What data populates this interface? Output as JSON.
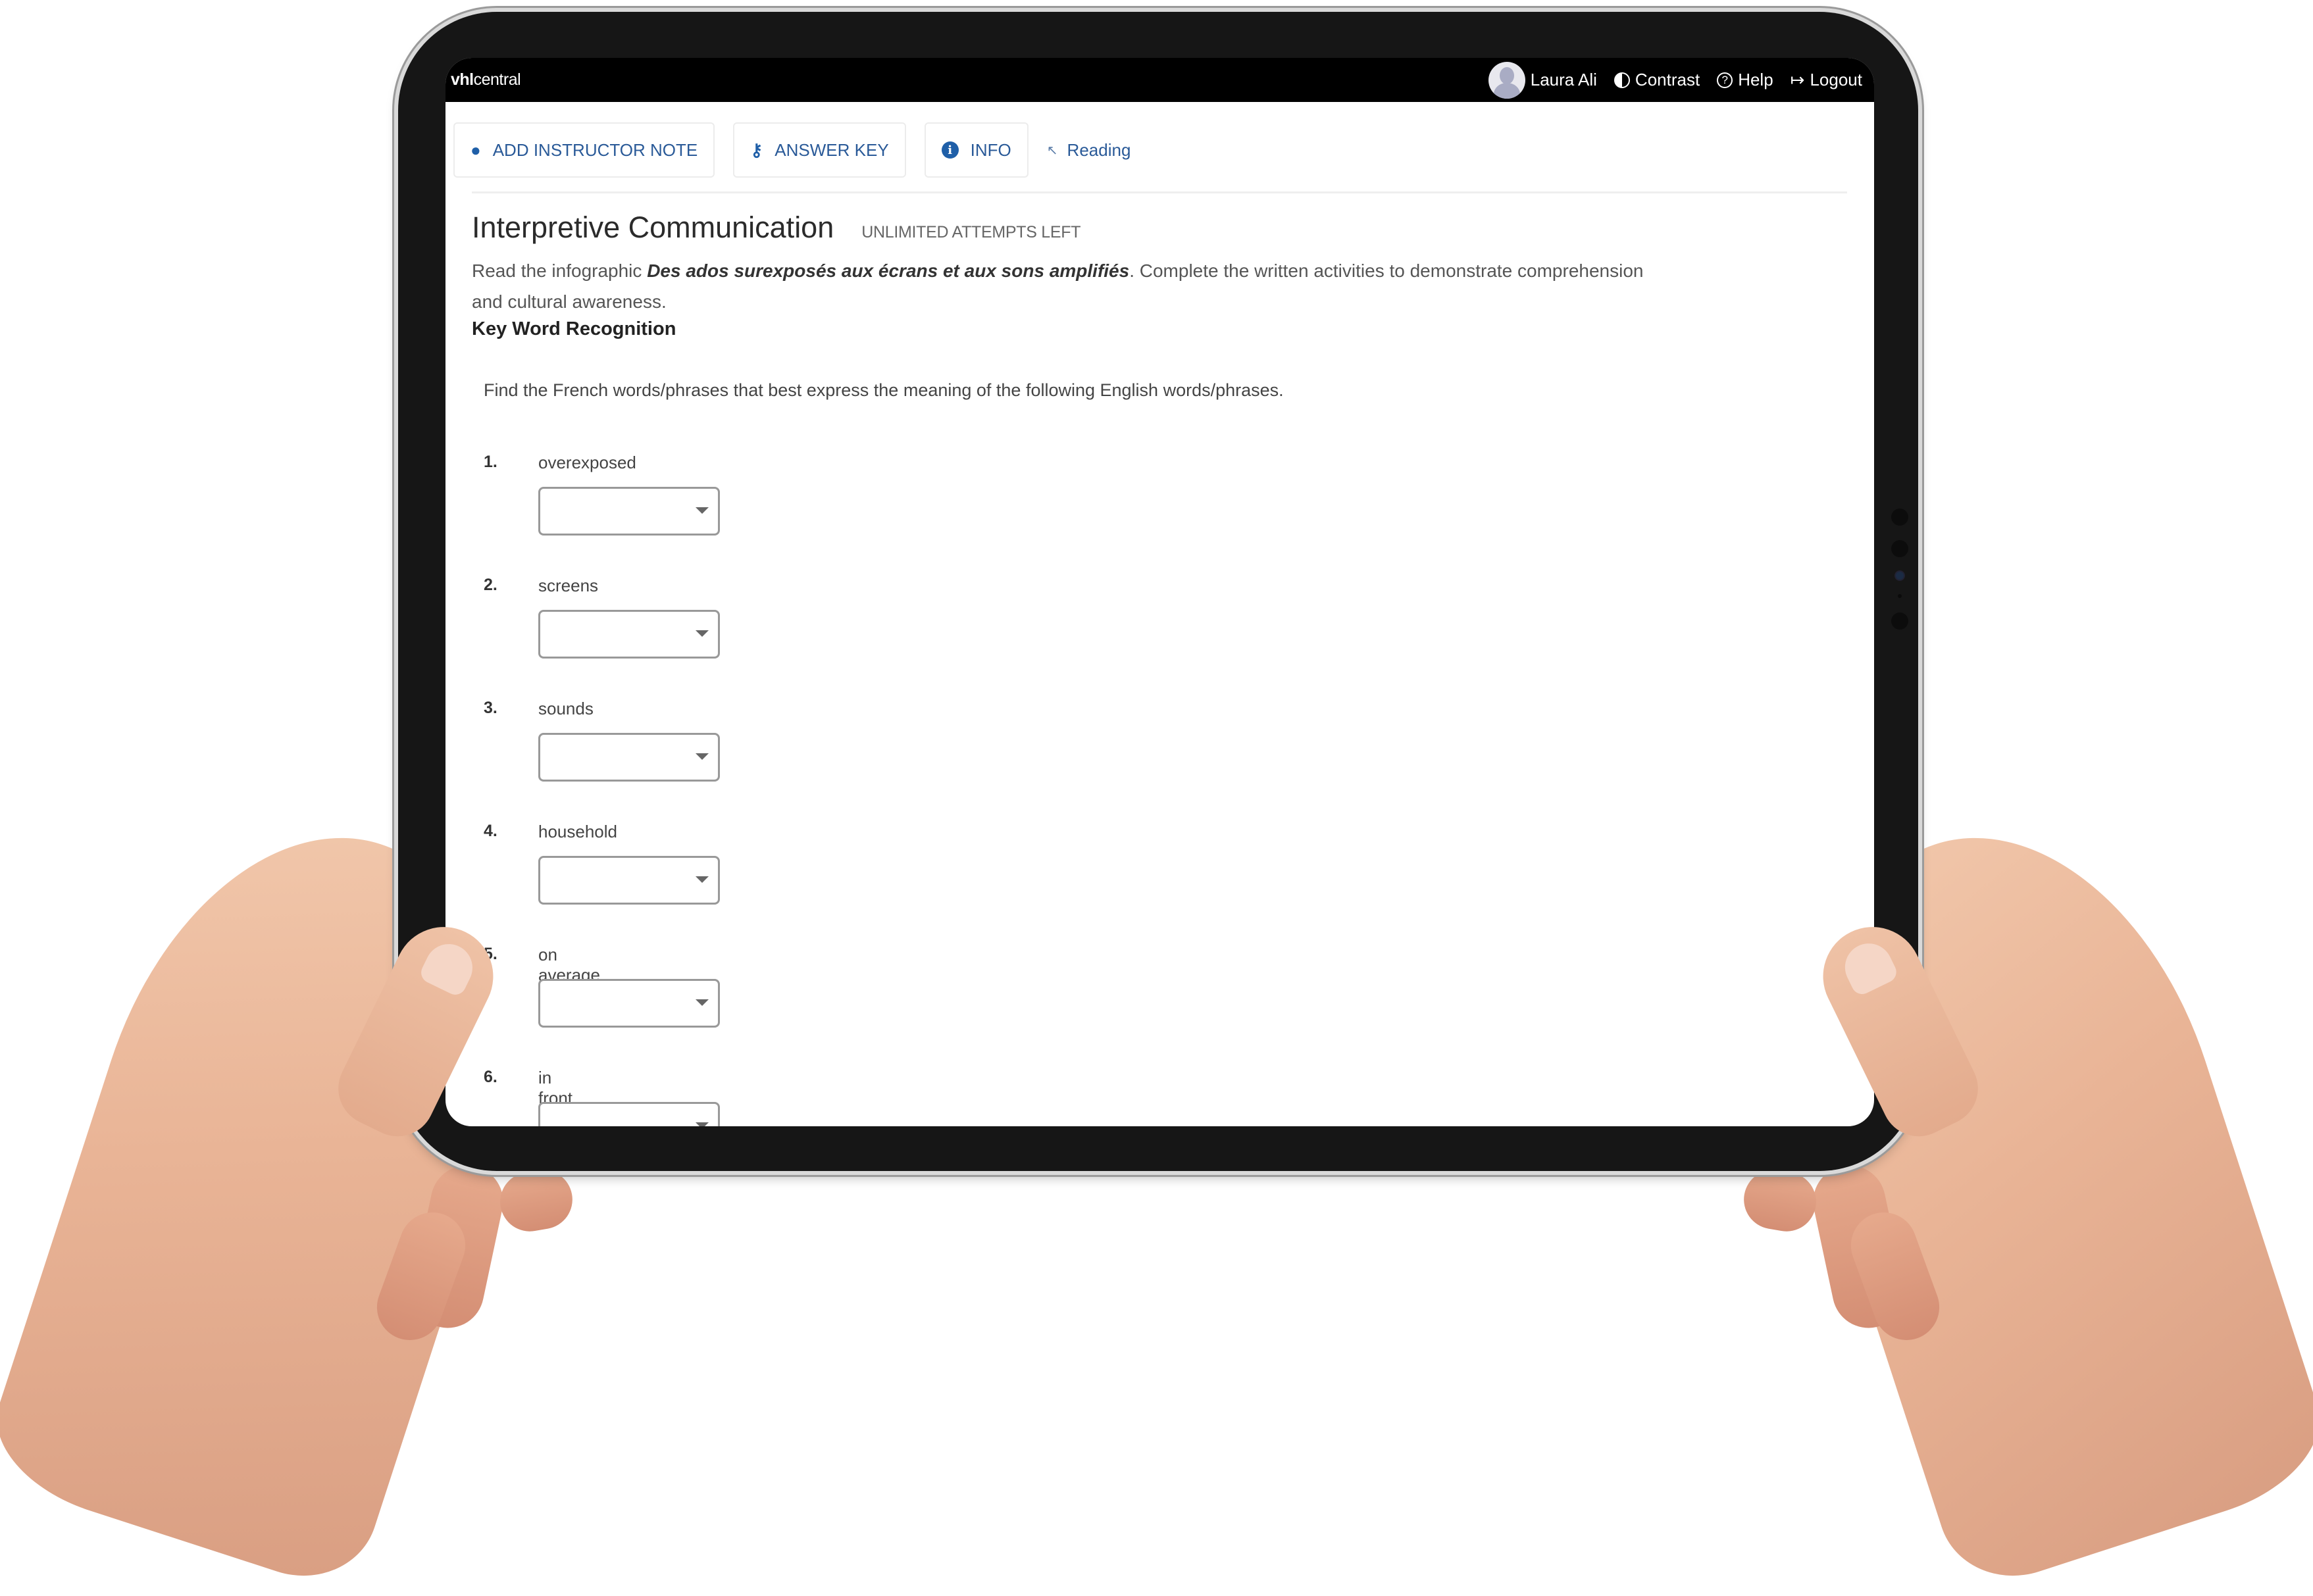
{
  "navbar": {
    "brand_bold": "vhl",
    "brand_rest": "central",
    "user_name": "Laura Ali",
    "contrast_label": "Contrast",
    "help_label": "Help",
    "logout_label": "Logout"
  },
  "toolbar": {
    "add_note_label": "ADD INSTRUCTOR NOTE",
    "answer_key_label": "ANSWER KEY",
    "info_label": "INFO",
    "reading_label": "Reading"
  },
  "activity": {
    "title": "Interpretive Communication",
    "attempts": "UNLIMITED ATTEMPTS LEFT",
    "intro_prefix": "Read the infographic ",
    "intro_title": "Des ados surexposés aux écrans et aux sons amplifiés",
    "intro_suffix": ". Complete the written activities to demonstrate comprehension and cultural awareness.",
    "section_heading": "Key Word Recognition",
    "instructions": "Find the French words/phrases that best express the meaning of the following English words/phrases."
  },
  "questions": [
    {
      "number": "1.",
      "prompt": "overexposed",
      "selected": ""
    },
    {
      "number": "2.",
      "prompt": "screens",
      "selected": ""
    },
    {
      "number": "3.",
      "prompt": "sounds",
      "selected": ""
    },
    {
      "number": "4.",
      "prompt": "household",
      "selected": ""
    },
    {
      "number": "5.",
      "prompt": "on average",
      "selected": ""
    },
    {
      "number": "6.",
      "prompt": "in front of",
      "selected": ""
    }
  ],
  "colors": {
    "accent": "#1f5fa8",
    "navbar_bg": "#000000",
    "tablet_bezel": "#161616"
  }
}
